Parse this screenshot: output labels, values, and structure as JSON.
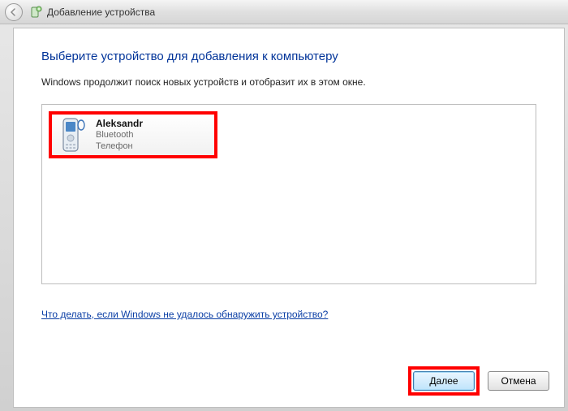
{
  "titlebar": {
    "title": "Добавление устройства"
  },
  "main": {
    "heading": "Выберите устройство для добавления к компьютеру",
    "subtext": "Windows продолжит поиск новых устройств и отобразит их в этом окне."
  },
  "devices": [
    {
      "name": "Aleksandr",
      "connection": "Bluetooth",
      "type": "Телефон"
    }
  ],
  "help": {
    "link_text": "Что делать, если Windows не удалось обнаружить устройство?"
  },
  "buttons": {
    "next": "Далее",
    "cancel": "Отмена"
  }
}
